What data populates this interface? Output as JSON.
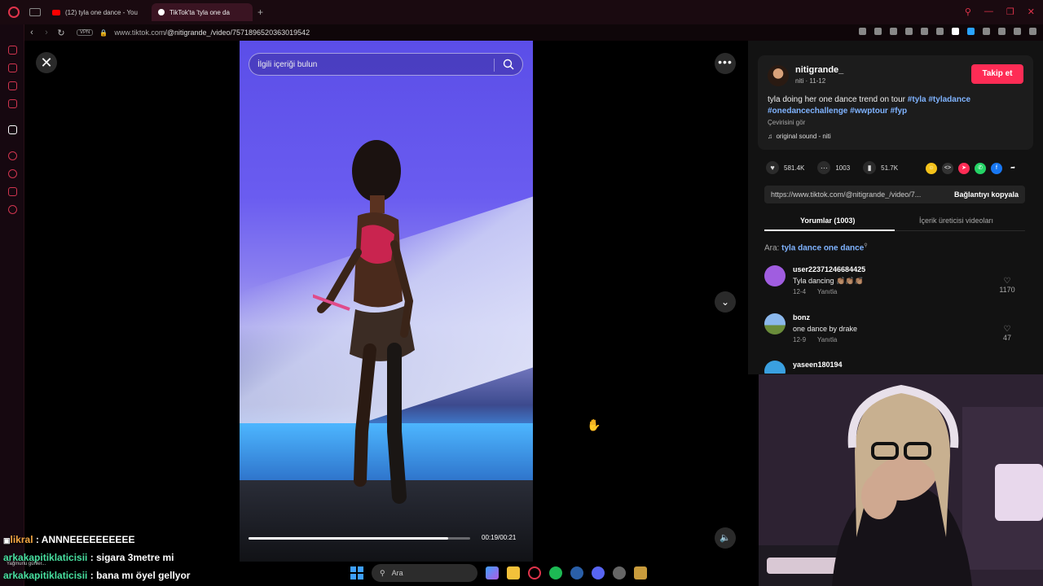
{
  "browser": {
    "tabs": [
      {
        "title": "(12) tyla one dance - You",
        "favicon_color": "#ff0000"
      },
      {
        "title": "TikTok'ta 'tyla one da",
        "favicon_color": "#ffffff",
        "active": true
      }
    ],
    "new_tab_label": "+",
    "url_prefix": "www.tiktok.com",
    "url_path": "/@nitigrande_/video/7571896520363019542",
    "vpn_label": "VPN"
  },
  "viewer": {
    "search_placeholder": "İlgili içeriği bulun",
    "time_label": "00:19/00:21",
    "progress": 0.9
  },
  "post": {
    "author": "nitigrande_",
    "sub": "niti · 11-12",
    "follow_label": "Takip et",
    "description": "tyla doing her one dance trend on tour",
    "tags_line1": "#tyla #tyladance",
    "tags_line2": "#onedancechallenge #wwptour #fyp",
    "translate_label": "Çevirisini gör",
    "sound": "original sound - niti",
    "likes": "581.4K",
    "comments": "1003",
    "saves": "51.7K",
    "link": "https://www.tiktok.com/@nitigrande_/video/7...",
    "copy_label": "Bağlantıyı kopyala",
    "tab_comments": "Yorumlar (1003)",
    "tab_creator": "İçerik üreticisi videoları",
    "search_prefix": "Ara:",
    "search_query": "tyla dance one dance"
  },
  "comments": [
    {
      "user": "user22371246684425",
      "text": "Tyla dancing 👏🏽👏🏽👏🏽",
      "date": "12-4",
      "reply": "Yanıtla",
      "likes": "1170",
      "avatar_color": "#a05de0"
    },
    {
      "user": "bonz",
      "text": "one dance by drake",
      "date": "12-9",
      "reply": "Yanıtla",
      "likes": "47",
      "avatar_color": "#6fa0d8"
    },
    {
      "user": "yaseen180194",
      "text": "",
      "date": "",
      "reply": "",
      "likes": "",
      "avatar_color": "#3aa0e0"
    }
  ],
  "chat": [
    {
      "user": "likral",
      "message": ": ANNNEEEEEEEEEE"
    },
    {
      "user": "arkakapitiklaticisii",
      "message": ": sigara 3metre mi"
    },
    {
      "user": "arkakapitiklaticisii",
      "message": ": bana mı öyel gellyor"
    }
  ],
  "taskbar": {
    "search_label": "Ara",
    "weather": "Yağmurlu günler..."
  },
  "colors": {
    "accent": "#fe2c55",
    "tag": "#7fb3ff",
    "opera_red": "#e0344b"
  }
}
